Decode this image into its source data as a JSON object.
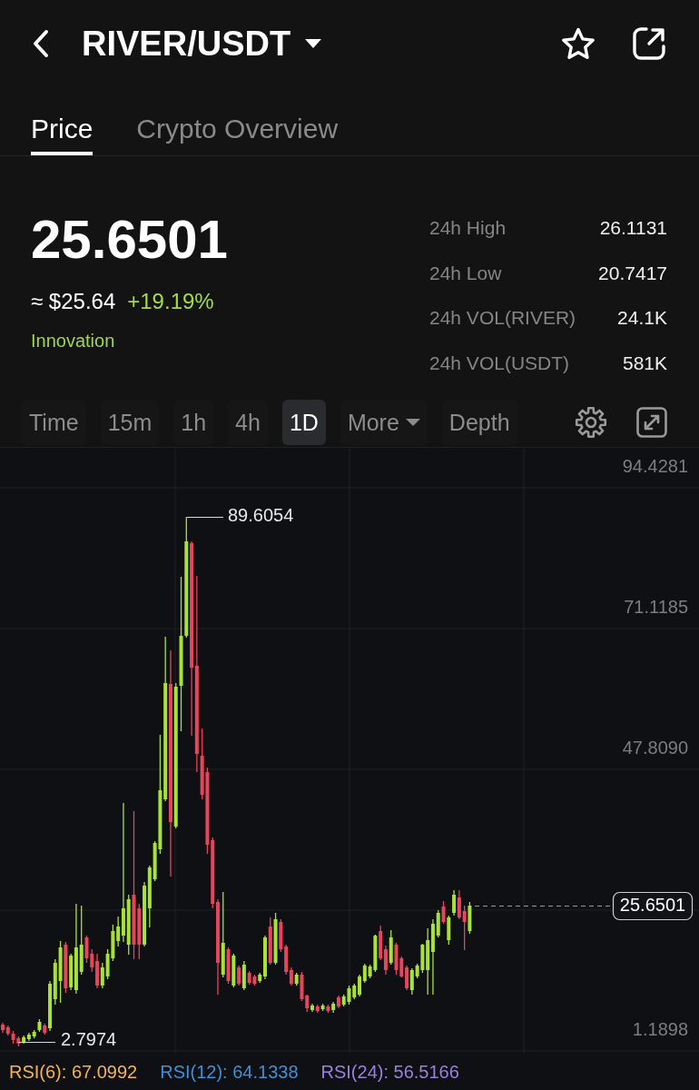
{
  "header": {
    "pair": "RIVER/USDT"
  },
  "tabs": [
    {
      "label": "Price",
      "selected": true
    },
    {
      "label": "Crypto Overview",
      "selected": false
    }
  ],
  "price": {
    "value": "25.6501",
    "fiat": "≈ $25.64",
    "change": "+19.19%",
    "tag": "Innovation"
  },
  "stats": [
    {
      "label": "24h High",
      "value": "26.1131"
    },
    {
      "label": "24h Low",
      "value": "20.7417"
    },
    {
      "label": "24h VOL(RIVER)",
      "value": "24.1K"
    },
    {
      "label": "24h VOL(USDT)",
      "value": "581K"
    }
  ],
  "toolbar": [
    {
      "label": "Time",
      "kind": "option",
      "selected": false
    },
    {
      "label": "15m",
      "kind": "option",
      "selected": false
    },
    {
      "label": "1h",
      "kind": "option",
      "selected": false
    },
    {
      "label": "4h",
      "kind": "option",
      "selected": false
    },
    {
      "label": "1D",
      "kind": "option",
      "selected": true
    },
    {
      "label": "More",
      "kind": "dropdown",
      "selected": false
    },
    {
      "label": "Depth",
      "kind": "option",
      "selected": false
    }
  ],
  "chart": {
    "axis_labels": [
      "94.4281",
      "71.1185",
      "47.8090",
      "1.1898"
    ],
    "high": "89.6054",
    "low": "2.7974",
    "last_price": "25.6501"
  },
  "indicators": [
    {
      "label": "RSI(6): 67.0992",
      "color": "#f3b44f"
    },
    {
      "label": "RSI(12): 64.1338",
      "color": "#3f8fd6"
    },
    {
      "label": "RSI(24): 56.5166",
      "color": "#9a80dc"
    }
  ]
}
